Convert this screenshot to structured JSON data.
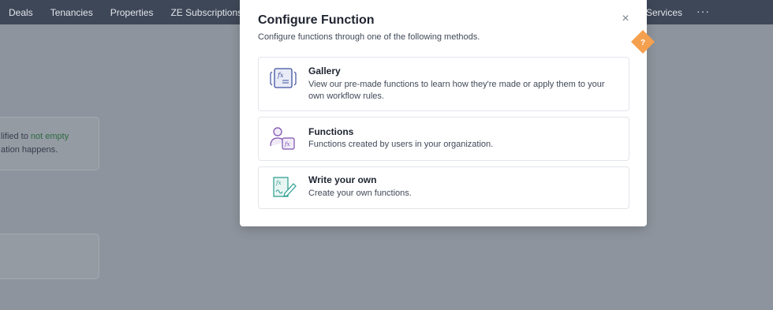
{
  "topnav": {
    "items": [
      "Deals",
      "Tenancies",
      "Properties",
      "ZE Subscriptions"
    ],
    "right_items": [
      "Services"
    ],
    "more_label": "···"
  },
  "background": {
    "card1": {
      "line1_prefix": "lified to ",
      "line1_highlight": "not empty",
      "line2": "ation happens."
    }
  },
  "modal": {
    "title": "Configure Function",
    "subtitle": "Configure functions through one of the following methods.",
    "close_label": "×",
    "help_label": "?",
    "options": [
      {
        "title": "Gallery",
        "description": "View our pre-made functions to learn how they're made or apply them to your own workflow rules.",
        "icon": "gallery-function-icon"
      },
      {
        "title": "Functions",
        "description": "Functions created by users in your organization.",
        "icon": "user-function-icon"
      },
      {
        "title": "Write your own",
        "description": "Create your own functions.",
        "icon": "write-function-icon"
      }
    ]
  },
  "colors": {
    "nav_bg": "#3e4757",
    "overlay": "#8e949d",
    "help_orange": "#f4a04f",
    "icon_blue": "#3e4f9e",
    "icon_purple": "#7b4fae",
    "icon_teal": "#2a9d8f"
  }
}
